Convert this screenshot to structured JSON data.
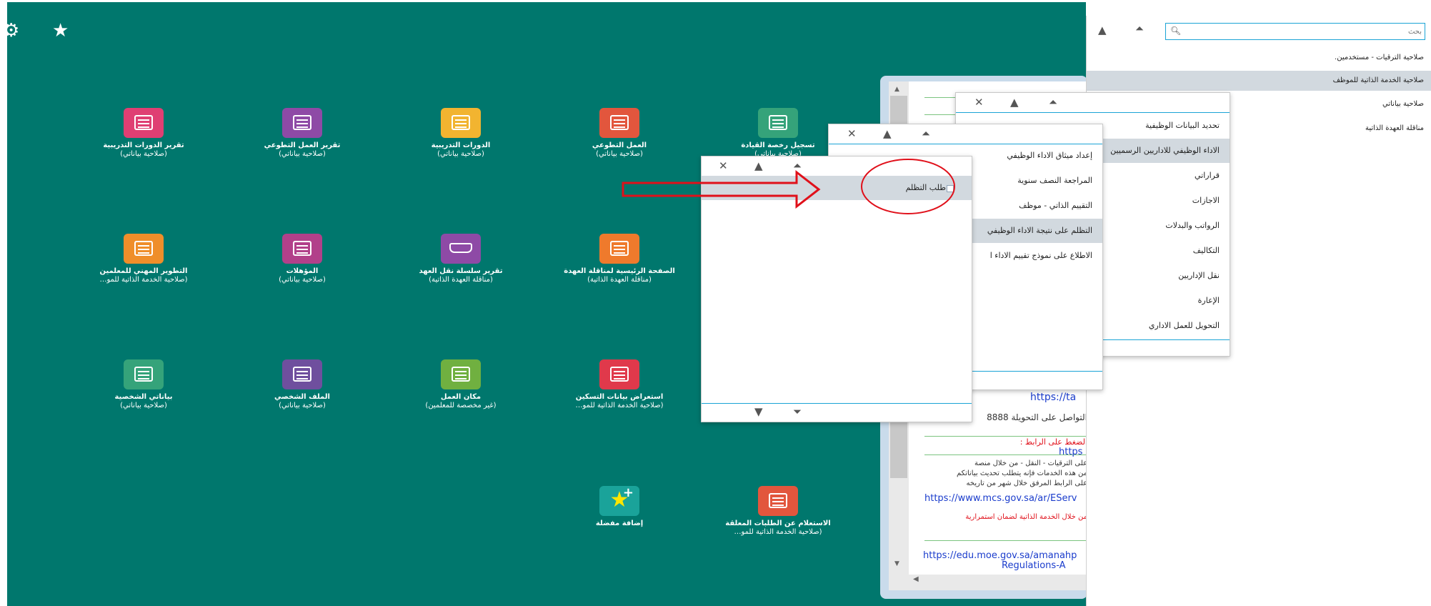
{
  "toolbar": {
    "settings_icon": "gear-icon",
    "favorite_icon": "star-icon"
  },
  "tiles": [
    {
      "id": "tile-1",
      "title": "تسجيل رخصة القيادة",
      "subtitle": "(صلاحية بياناتي)",
      "color": "#35a37a",
      "icon": "document-icon"
    },
    {
      "id": "tile-2",
      "title": "العمل التطوعي",
      "subtitle": "(صلاحية بياناتي)",
      "color": "#e2563d",
      "icon": "document-icon"
    },
    {
      "id": "tile-3",
      "title": "الدورات التدريبية",
      "subtitle": "(صلاحية بياناتي)",
      "color": "#f2b430",
      "icon": "document-icon"
    },
    {
      "id": "tile-4",
      "title": "تقرير العمل التطوعي",
      "subtitle": "(صلاحية بياناتي)",
      "color": "#8e4aa6",
      "icon": "document-icon"
    },
    {
      "id": "tile-5",
      "title": "تقرير الدورات التدريبية",
      "subtitle": "(صلاحية بياناتي)",
      "color": "#df3f73",
      "icon": "document-icon"
    },
    {
      "id": "tile-6",
      "title": "الصفحة الرئيسية لمناقلة العهدة",
      "subtitle": "(مناقلة العهدة الذاتية)",
      "color": "#ef7a2c",
      "icon": "document-icon"
    },
    {
      "id": "tile-7",
      "title": "تقرير سلسلة نقل العهد",
      "subtitle": "(مناقلة العهدة الذاتية)",
      "color": "#8e4aa6",
      "icon": "glasses-icon"
    },
    {
      "id": "tile-8",
      "title": "المؤهلات",
      "subtitle": "(صلاحية بياناتي)",
      "color": "#b2408a",
      "icon": "document-icon"
    },
    {
      "id": "tile-9",
      "title": "التطوير المهني للمعلمين",
      "subtitle": "(صلاحية الخدمة الذاتية للمو…",
      "color": "#ef8e2a",
      "icon": "document-icon"
    },
    {
      "id": "tile-10",
      "title": "استعراض بيانات التسكين",
      "subtitle": "(صلاحية الخدمة الذاتية للمو…",
      "color": "#e0394b",
      "icon": "document-icon"
    },
    {
      "id": "tile-11",
      "title": "مكان العمل",
      "subtitle": "(غير مخصصة للمعلمين)",
      "color": "#70b040",
      "icon": "document-icon"
    },
    {
      "id": "tile-12",
      "title": "الملف الشخصي",
      "subtitle": "(صلاحية بياناتي)",
      "color": "#6f4f9e",
      "icon": "document-icon"
    },
    {
      "id": "tile-13",
      "title": "بياناتي الشخصية",
      "subtitle": "(صلاحية بياناتي)",
      "color": "#35a37a",
      "icon": "document-icon"
    },
    {
      "id": "tile-14",
      "title": "الاستعلام عن الطلبات المعلقة",
      "subtitle": "(صلاحية الخدمة الذاتية للمو…",
      "color": "#e2563d",
      "icon": "document-icon"
    },
    {
      "id": "tile-15",
      "title": "إضافة مفضلة",
      "subtitle": "",
      "color": "#1aa39a",
      "icon": "star-plus-icon"
    }
  ],
  "browser": {
    "lines": [
      "https://ta",
      "التواصل على التحويلة 8888",
      "الضغط على الرابط :",
      "https",
      "على الترقيات - النقل - من خلال منصة",
      "من هذه الخدمات فإنه يتطلب تحديث بياناتكم",
      "على الرابط المرفق خلال شهر من تاريخه",
      "https://www.mcs.gov.sa/ar/EServ",
      "من خلال الخدمة الذاتية لضمان استمرارية",
      "https://edu.moe.gov.sa/amanahp",
      "Regulations-A"
    ]
  },
  "menu1": {
    "items": [
      "إعداد ميثاق الاداء الوظيفي",
      "المراجعة النصف سنوية",
      "التقييم الذاتي - موظف",
      "التظلم على نتيجة الاداء الوظيفي",
      "الاطلاع على نموذج تقييم الاداء ا"
    ]
  },
  "menu2": {
    "items": [
      "تحديد البيانات الوظيفية",
      "الاداء الوظيفي للاداريين الرسميين",
      "قراراتي",
      "الاجازات",
      "الرواتب والبدلات",
      "التكاليف",
      "نقل الإداريين",
      "الإعارة",
      "التحويل للعمل الاداري"
    ]
  },
  "menu3": {
    "items": [
      "طلب التظلم"
    ]
  },
  "right_panel": {
    "search_placeholder": "بحث",
    "items": [
      "صلاحية الترقيات - مستخدمين.",
      "صلاحية الخدمة الذاتية للموظف",
      "صلاحية بياناتي",
      "مناقلة العهدة الذاتية"
    ]
  },
  "colors": {
    "desktop": "#00776d",
    "accent_line": "#1aa3d6",
    "annotation": "#e0101a",
    "link": "#1a3ccc"
  }
}
